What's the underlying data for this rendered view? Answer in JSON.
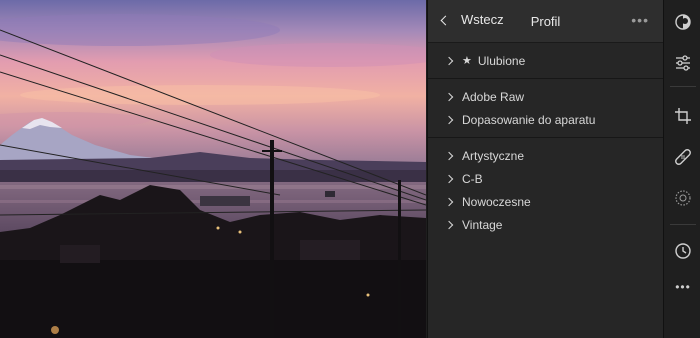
{
  "header": {
    "back_label": "Wstecz",
    "title": "Profil",
    "more_label": "•••"
  },
  "favorites": {
    "star": "★",
    "label": "Ulubione"
  },
  "groups": [
    {
      "label": "Adobe Raw"
    },
    {
      "label": "Dopasowanie do aparatu"
    }
  ],
  "creative": [
    {
      "label": "Artystyczne"
    },
    {
      "label": "C-B"
    },
    {
      "label": "Nowoczesne"
    },
    {
      "label": "Vintage"
    }
  ],
  "rail": {
    "more_label": "•••",
    "tools": [
      "profile-icon",
      "sliders-icon",
      "crop-icon",
      "bandage-icon",
      "radial-icon",
      "history-icon"
    ]
  },
  "colors": {
    "panel_bg": "#262626",
    "header_bg": "#2e2e2e",
    "rail_bg": "#1f1f1f",
    "text": "#d8d8d8",
    "sky_pink": "#e39aa5",
    "sky_purple": "#7e6aa8"
  }
}
